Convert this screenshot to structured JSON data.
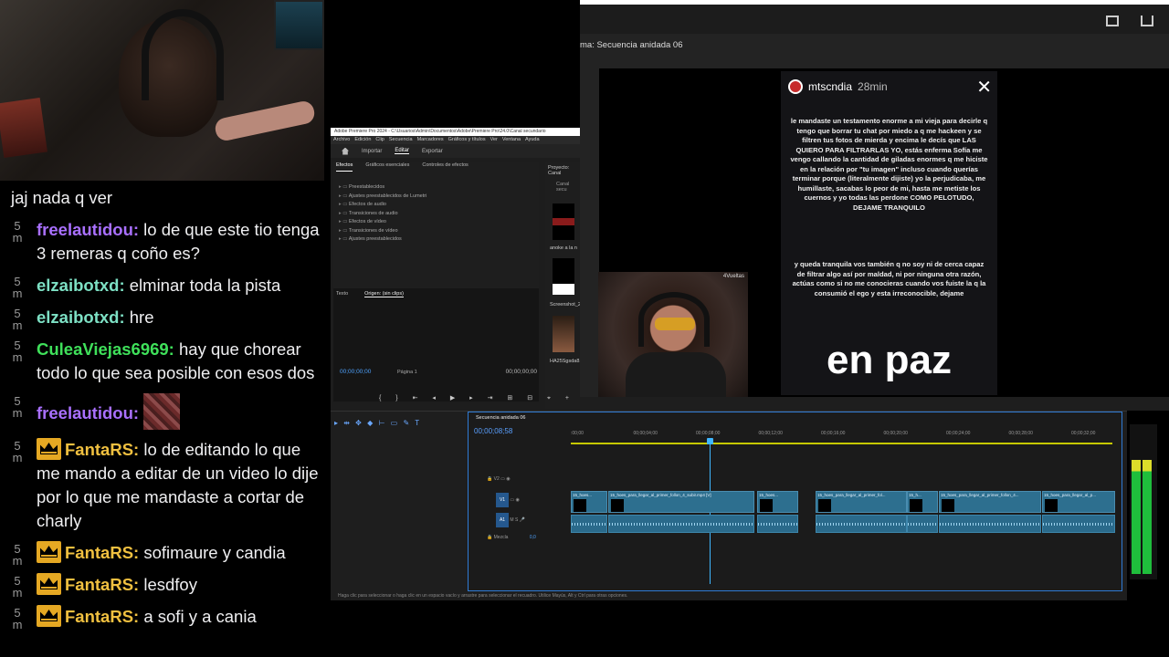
{
  "chat": {
    "messages": [
      {
        "time": "",
        "user": "",
        "crown": false,
        "text": "jaj nada q ver",
        "color": "#efeff1"
      },
      {
        "time": "5\nm",
        "user": "freelautidou:",
        "crown": false,
        "text": " lo de que este tio tenga 3 remeras q coño es?",
        "color": "#a970ff"
      },
      {
        "time": "5\nm",
        "user": "elzaibotxd:",
        "crown": false,
        "text": " elminar toda la pista",
        "color": "#7de0c4"
      },
      {
        "time": "5\nm",
        "user": "elzaibotxd:",
        "crown": false,
        "text": " hre",
        "color": "#7de0c4"
      },
      {
        "time": "5\nm",
        "user": "CuleaViejas6969:",
        "crown": false,
        "text": " hay que chorear todo lo que sea posible con esos dos",
        "color": "#3fe05a"
      },
      {
        "time": "5\nm",
        "user": "freelautidou:",
        "crown": false,
        "text": "",
        "emote": true,
        "color": "#a970ff"
      },
      {
        "time": "5\nm",
        "user": "FantaRS:",
        "crown": true,
        "text": " lo de editando lo que me mando a editar de un video lo dije por lo que me mandaste a cortar de charly",
        "color": "#f0c040"
      },
      {
        "time": "5\nm",
        "user": "FantaRS:",
        "crown": true,
        "text": " sofimaure y candia",
        "color": "#f0c040"
      },
      {
        "time": "5\nm",
        "user": "FantaRS:",
        "crown": true,
        "text": " lesdfoy",
        "color": "#f0c040"
      },
      {
        "time": "5\nm",
        "user": "FantaRS:",
        "crown": true,
        "text": " a sofi y a cania",
        "color": "#f0c040"
      }
    ]
  },
  "premiere": {
    "title": "Adobe Premiere Pro 2024 - C:\\Usuarios\\Admin\\Documentos\\Adobe\\Premiere Pro\\24.0\\Canal secundario",
    "menu": [
      "Archivo",
      "Edición",
      "Clip",
      "Secuencia",
      "Marcadores",
      "Gráficos y títulos",
      "Ver",
      "Ventana",
      "Ayuda"
    ],
    "tabs": {
      "import": "Importar",
      "edit": "Editar",
      "export": "Exportar"
    },
    "effects_tabs": [
      "Efectos",
      "Gráficos esenciales",
      "Controles de efectos"
    ],
    "effects_list": [
      "Preestablecidos",
      "Ajustes preestablecidos de Lumetri",
      "Efectos de audio",
      "Transiciones de audio",
      "Efectos de vídeo",
      "Transiciones de vídeo",
      "Ajustes preestablecidos"
    ],
    "project": {
      "title": "Proyecto: Canal",
      "sub": "Canal secu",
      "item1": "anoke a la n",
      "item2": "Screenshot_2",
      "item3": "HA25Sgsda8..."
    },
    "source": {
      "tab1": "Texto",
      "tab2": "Origen: (sin clips)",
      "tc_left": "00;00;00;00",
      "page": "Página 1",
      "tc_right": "00;00;00;00"
    },
    "timeline": {
      "tab": "Secuencia anidada 06",
      "timecode": "00;00;08;58",
      "ruler": [
        ":00;00",
        "00;00;04;00",
        "00;00;08;00",
        "00;00;12;00",
        "00;00;16;00",
        "00;00;20;00",
        "00;00;24;00",
        "00;00;28;00",
        "00;00;32;00"
      ],
      "tracks": {
        "v1": "V1",
        "a1": "A1",
        "mix": "Mezcla",
        "mixval": "0,0"
      },
      "clips": [
        "15_hoes...",
        "15_hoes_para_llegar_al_primer_follon_4_subir.mp4 [V]",
        "15_hoes...",
        "15_hoes_para_llegar_al_primer_fol...",
        "15_h...",
        "15_hoes_para_llegar_al_primer_follon_4...",
        "15_hoes_para_llegar_al_p..."
      ]
    },
    "status": "Haga clic para seleccionar o haga clic en un espacio vacío y arrastre para seleccionar el recuadro. Utilice Mayús, Alt y Ctrl para otras opciones."
  },
  "program": {
    "title": "ma: Secuencia anidada 06",
    "story": {
      "username": "mtscndia",
      "time": "28min",
      "para1": "le mandaste un testamento enorme a mi vieja para decirle q tengo que borrar tu chat por miedo a q me hackeen y se filtren tus fotos de mierda y encima le decís que LAS QUIERO PARA FILTRARLAS YO, estás enferma Sofía me vengo callando la cantidad de giladas enormes q me hiciste en la relación por \"tu imagen\" incluso cuando querías terminar porque (literalmente dijiste) yo la perjudicaba, me humillaste, sacabas lo peor de mi, hasta me metiste los cuernos y yo todas las perdone COMO PELOTUDO, DEJAME TRANQUILO",
      "para2": "y queda tranquila vos también q no soy ni de cerca capaz de filtrar algo así por maldad, ni por ninguna otra razón, actúas como si no me conocieras cuando vos fuiste la q la consumió el ego y esta irreconocible, dejame",
      "big": "en paz"
    },
    "cam_tag": "4Vueltas"
  }
}
